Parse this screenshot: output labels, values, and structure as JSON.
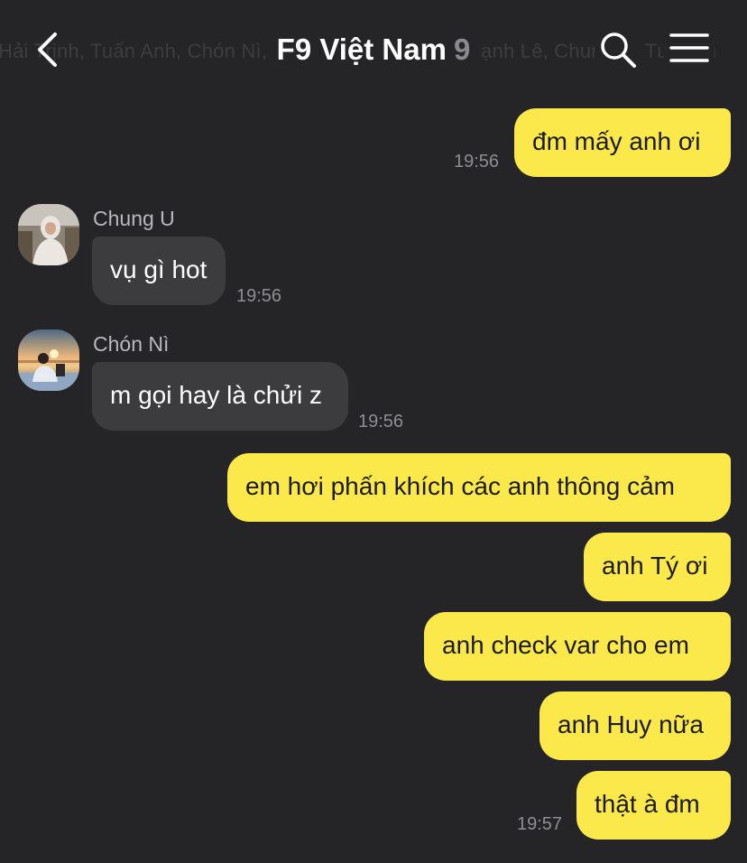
{
  "header": {
    "back_icon": "chevron-left-icon",
    "title": "F9 Việt Nam",
    "member_count": "9",
    "members_preview": "Hải Trịnh, Tuấn Anh, Chón Nì, Gia Huy, Tý Nguyễn, Mạnh Lê, Chung U, Tư Trần",
    "search_icon": "search-icon",
    "menu_icon": "hamburger-menu-icon"
  },
  "messages": [
    {
      "side": "me",
      "text": "đm mấy anh ơi",
      "time": "19:56"
    },
    {
      "side": "them",
      "sender": "Chung U",
      "text": "vụ gì hot",
      "time": "19:56"
    },
    {
      "side": "them",
      "sender": "Chón Nì",
      "text": "m gọi hay là chửi z",
      "time": "19:56"
    },
    {
      "side": "me",
      "text": "em hơi phấn khích các anh thông cảm"
    },
    {
      "side": "me",
      "text": "anh Tý ơi"
    },
    {
      "side": "me",
      "text": "anh check var cho em"
    },
    {
      "side": "me",
      "text": "anh Huy nữa"
    },
    {
      "side": "me",
      "text": "thật à đm",
      "time": "19:57"
    }
  ],
  "colors": {
    "background": "#252527",
    "my_bubble": "#fbe84a",
    "their_bubble": "#3c3c3e",
    "timestamp": "#8e8e92"
  }
}
